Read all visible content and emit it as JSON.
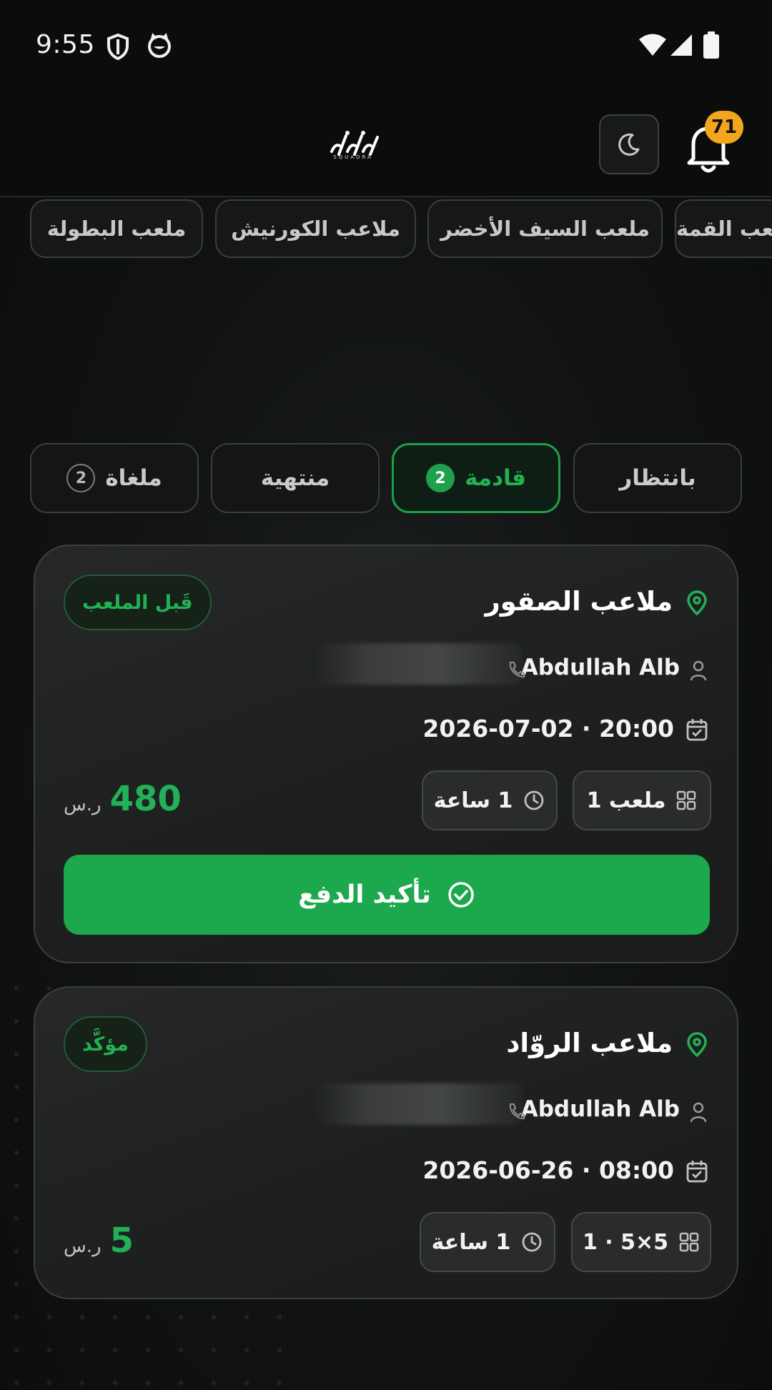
{
  "status_bar": {
    "time": "9:55"
  },
  "header": {
    "logo_text": "SQUADRA",
    "notification_count": "71",
    "colors": {
      "accent": "#1ca84d",
      "badge": "#f2a51d"
    }
  },
  "stadium_filters": [
    {
      "label": "ملعب البطولة"
    },
    {
      "label": "ملاعب الكورنيش"
    },
    {
      "label": "ملعب السيف الأخضر"
    },
    {
      "label": "ملعب القمة"
    }
  ],
  "status_tabs": [
    {
      "label": "بانتظار",
      "count": null,
      "active": false
    },
    {
      "label": "قادمة",
      "count": "2",
      "active": true
    },
    {
      "label": "منتهية",
      "count": null,
      "active": false
    },
    {
      "label": "ملغاة",
      "count": "2",
      "active": false
    }
  ],
  "bookings": [
    {
      "stadium": "ملاعب الصقور",
      "status": "قَبل الملعب",
      "user": "Abdullah Alb",
      "datetime": "2026-07-02 · 20:00",
      "field": "ملعب 1",
      "duration": "1 ساعة",
      "price": "480",
      "currency": "ر.س",
      "confirm_label": "تأكيد الدفع"
    },
    {
      "stadium": "ملاعب الروّاد",
      "status": "مؤكَّد",
      "user": "Abdullah Alb",
      "datetime": "2026-06-26 · 08:00",
      "field": "5×5 · 1",
      "duration": "1 ساعة",
      "price": "5",
      "currency": "ر.س"
    }
  ]
}
